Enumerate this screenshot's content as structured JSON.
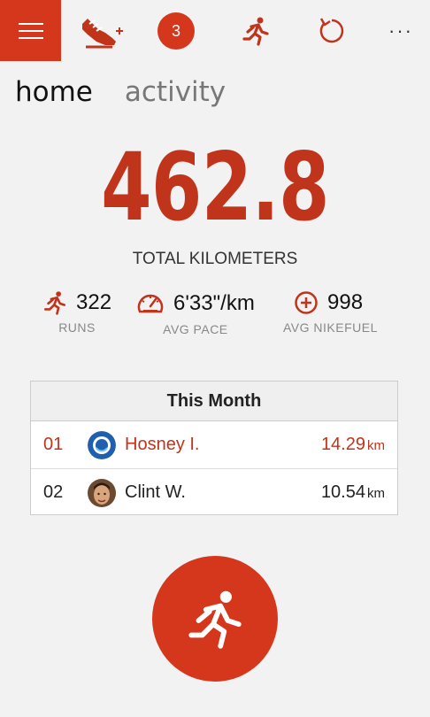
{
  "topbar": {
    "notification_count": "3",
    "more_label": "···"
  },
  "tabs": [
    {
      "label": "home"
    },
    {
      "label": "activity"
    }
  ],
  "summary": {
    "total": "462.8",
    "total_label": "TOTAL KILOMETERS"
  },
  "stats": [
    {
      "value": "322",
      "label": "RUNS",
      "icon": "runner-icon"
    },
    {
      "value": "6'33\"/km",
      "label": "AVG PACE",
      "icon": "speedometer-icon"
    },
    {
      "value": "998",
      "label": "AVG NIKEFUEL",
      "icon": "plus-circle-icon"
    }
  ],
  "leaderboard": {
    "title": "This Month",
    "rows": [
      {
        "rank": "01",
        "name": "Hosney I.",
        "distance": "14.29",
        "unit": "km"
      },
      {
        "rank": "02",
        "name": "Clint W.",
        "distance": "10.54",
        "unit": "km"
      }
    ]
  },
  "colors": {
    "accent": "#d4371c",
    "accent_text": "#c0341c"
  }
}
